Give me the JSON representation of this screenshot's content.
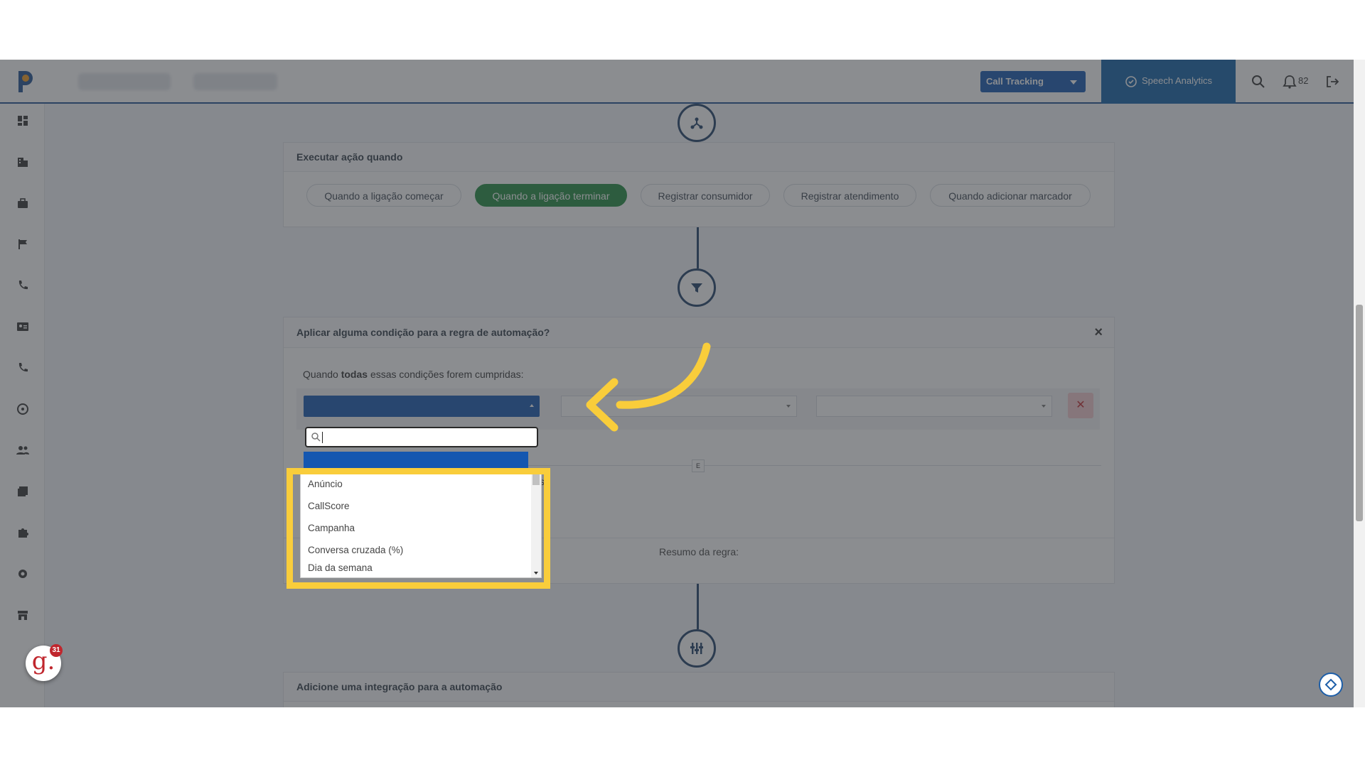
{
  "topbar": {
    "product_select_label": "Call Tracking",
    "speech_analytics_label": "Speech Analytics",
    "notifications_count": "82"
  },
  "trigger_card": {
    "title": "Executar ação quando",
    "options": [
      {
        "label": "Quando a ligação começar",
        "active": false
      },
      {
        "label": "Quando a ligação terminar",
        "active": true
      },
      {
        "label": "Registrar consumidor",
        "active": false
      },
      {
        "label": "Registrar atendimento",
        "active": false
      },
      {
        "label": "Quando adicionar marcador",
        "active": false
      }
    ]
  },
  "condition_card": {
    "title": "Aplicar alguma condição para a regra de automação?",
    "close_label": "×",
    "intro_prefix": "Quando ",
    "intro_bold": "todas",
    "intro_suffix": " essas condições forem cumpridas:",
    "separator_label": "E",
    "partial_text": "s:",
    "summary_label": "Resumo da regra:",
    "remove_label": "✕"
  },
  "dropdown": {
    "search_value": "",
    "options": [
      "Anúncio",
      "CallScore",
      "Campanha",
      "Conversa cruzada (%)",
      "Dia da semana"
    ]
  },
  "integration_card": {
    "title": "Adicione uma integração para a automação"
  },
  "widgets": {
    "avatar_letter": "g.",
    "avatar_badge": "31"
  },
  "colors": {
    "primary": "#1557b0",
    "active_green": "#1f8a3e",
    "highlight_yellow": "#f9cd3b",
    "node_border": "#1d3f68"
  }
}
